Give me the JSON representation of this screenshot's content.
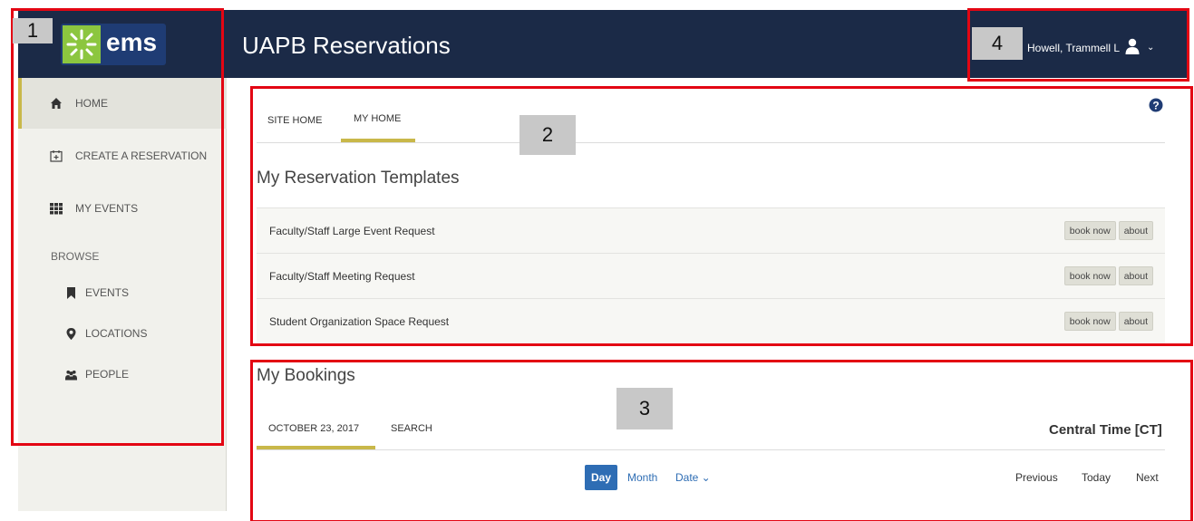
{
  "header": {
    "logo_text": "ems",
    "app_title": "UAPB Reservations",
    "user_name": "Howell, Trammell L",
    "user_caret": "⌄"
  },
  "sidebar": {
    "items": [
      {
        "label": "HOME",
        "icon": "home-icon",
        "active": true
      },
      {
        "label": "CREATE A RESERVATION",
        "icon": "calendar-plus-icon"
      },
      {
        "label": "MY EVENTS",
        "icon": "grid-icon"
      }
    ],
    "browse_label": "BROWSE",
    "browse_items": [
      {
        "label": "EVENTS",
        "icon": "bookmark-icon"
      },
      {
        "label": "LOCATIONS",
        "icon": "map-marker-icon"
      },
      {
        "label": "PEOPLE",
        "icon": "users-icon"
      }
    ]
  },
  "annotations": [
    "1",
    "2",
    "3",
    "4"
  ],
  "home_tabs": [
    {
      "label": "SITE HOME"
    },
    {
      "label": "MY HOME",
      "active": true
    }
  ],
  "templates": {
    "title": "My Reservation Templates",
    "book_label": "book now",
    "about_label": "about",
    "rows": [
      "Faculty/Staff Large Event Request",
      "Faculty/Staff Meeting Request",
      "Student Organization Space Request"
    ]
  },
  "bookings": {
    "title": "My Bookings",
    "tabs": [
      {
        "label": "OCTOBER 23, 2017",
        "active": true
      },
      {
        "label": "SEARCH"
      }
    ],
    "timezone": "Central Time [CT]",
    "views": {
      "day": "Day",
      "month": "Month",
      "date": "Date ⌄"
    },
    "pager": {
      "previous": "Previous",
      "today": "Today",
      "next": "Next"
    }
  },
  "colors": {
    "header_bg": "#1b2a47",
    "accent": "#c9b84a",
    "annotation": "#e30613",
    "primary": "#2e6db4"
  }
}
